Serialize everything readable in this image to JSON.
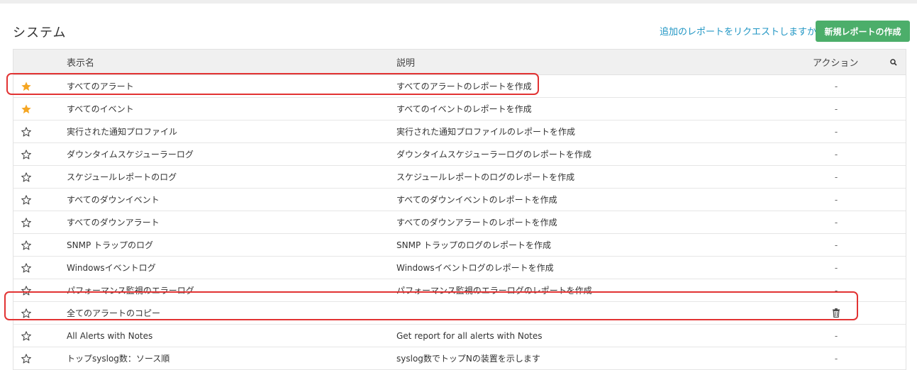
{
  "page": {
    "title": "システム"
  },
  "header": {
    "request_link": "追加のレポートをリクエストしますか？",
    "new_button": "新規レポートの作成"
  },
  "table": {
    "columns": {
      "name": "表示名",
      "description": "説明",
      "action": "アクション"
    },
    "rows": [
      {
        "favorite": true,
        "name": "すべてのアラート",
        "description": "すべてのアラートのレポートを作成",
        "action": "-"
      },
      {
        "favorite": true,
        "name": "すべてのイベント",
        "description": "すべてのイベントのレポートを作成",
        "action": "-"
      },
      {
        "favorite": false,
        "name": "実行された通知プロファイル",
        "description": "実行された通知プロファイルのレポートを作成",
        "action": "-"
      },
      {
        "favorite": false,
        "name": "ダウンタイムスケジューラーログ",
        "description": "ダウンタイムスケジューラーログのレポートを作成",
        "action": "-"
      },
      {
        "favorite": false,
        "name": "スケジュールレポートのログ",
        "description": "スケジュールレポートのログのレポートを作成",
        "action": "-"
      },
      {
        "favorite": false,
        "name": "すべてのダウンイベント",
        "description": "すべてのダウンイベントのレポートを作成",
        "action": "-"
      },
      {
        "favorite": false,
        "name": "すべてのダウンアラート",
        "description": "すべてのダウンアラートのレポートを作成",
        "action": "-"
      },
      {
        "favorite": false,
        "name": "SNMP トラップのログ",
        "description": "SNMP トラップのログのレポートを作成",
        "action": "-"
      },
      {
        "favorite": false,
        "name": "Windowsイベントログ",
        "description": "Windowsイベントログのレポートを作成",
        "action": "-"
      },
      {
        "favorite": false,
        "name": "パフォーマンス監視のエラーログ",
        "description": "パフォーマンス監視のエラーログのレポートを作成",
        "action": "-"
      },
      {
        "favorite": false,
        "name": "全てのアラートのコピー",
        "description": "",
        "action": "delete-icon"
      },
      {
        "favorite": false,
        "name": "All Alerts with Notes",
        "description": "Get report for all alerts with Notes",
        "action": "-"
      },
      {
        "favorite": false,
        "name": "トップsyslog数：ソース順",
        "description": "syslog数でトップNの装置を示します",
        "action": "-"
      }
    ]
  },
  "colors": {
    "accent_green": "#4cae6a",
    "link_blue": "#2196c4",
    "star_filled": "#f5a623",
    "highlight_red": "#e23333"
  }
}
